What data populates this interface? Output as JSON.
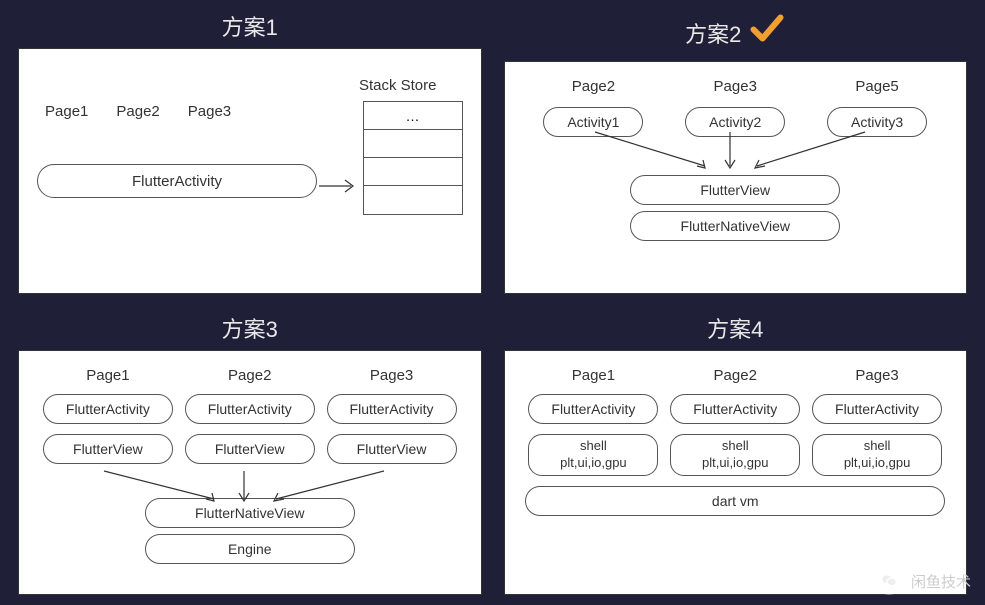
{
  "titles": {
    "p1": "方案1",
    "p2": "方案2",
    "p3": "方案3",
    "p4": "方案4"
  },
  "panel1": {
    "pages": [
      "Page1",
      "Page2",
      "Page3"
    ],
    "activity": "FlutterActivity",
    "stack_label": "Stack Store",
    "stack_rows": [
      "…",
      "",
      "",
      ""
    ]
  },
  "panel2": {
    "cols": [
      {
        "page": "Page2",
        "activity": "Activity1"
      },
      {
        "page": "Page3",
        "activity": "Activity2"
      },
      {
        "page": "Page5",
        "activity": "Activity3"
      }
    ],
    "flutter_view": "FlutterView",
    "native_view": "FlutterNativeView"
  },
  "panel3": {
    "cols": [
      {
        "page": "Page1",
        "activity": "FlutterActivity",
        "view": "FlutterView"
      },
      {
        "page": "Page2",
        "activity": "FlutterActivity",
        "view": "FlutterView"
      },
      {
        "page": "Page3",
        "activity": "FlutterActivity",
        "view": "FlutterView"
      }
    ],
    "native_view": "FlutterNativeView",
    "engine": "Engine"
  },
  "panel4": {
    "cols": [
      {
        "page": "Page1",
        "activity": "FlutterActivity",
        "shell1": "shell",
        "shell2": "plt,ui,io,gpu"
      },
      {
        "page": "Page2",
        "activity": "FlutterActivity",
        "shell1": "shell",
        "shell2": "plt,ui,io,gpu"
      },
      {
        "page": "Page3",
        "activity": "FlutterActivity",
        "shell1": "shell",
        "shell2": "plt,ui,io,gpu"
      }
    ],
    "vm": "dart vm"
  },
  "watermark": "闲鱼技术"
}
